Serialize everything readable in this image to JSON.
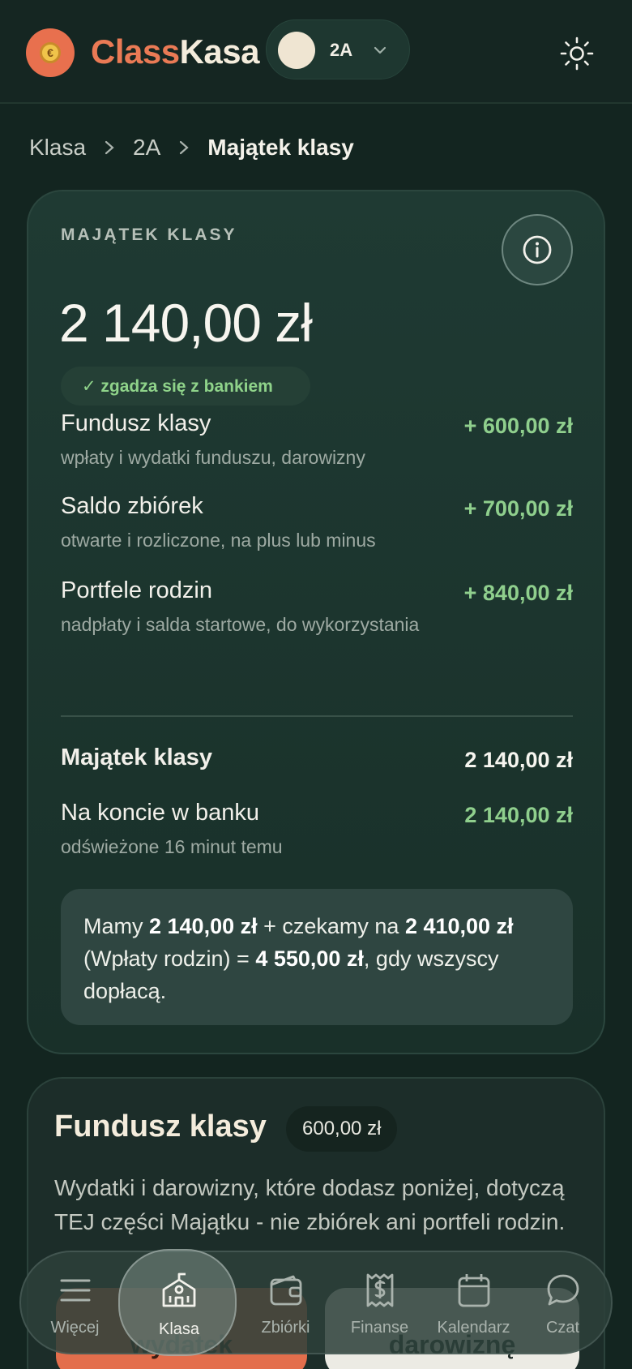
{
  "header": {
    "brand_part1": "Class",
    "brand_part2": "Kasa",
    "class_selector": "2A",
    "logo_icon": "coin-icon",
    "theme_icon": "sun-icon"
  },
  "breadcrumb": {
    "items": [
      "Klasa",
      "2A",
      "Majątek klasy"
    ]
  },
  "wealth_card": {
    "eyebrow": "MAJĄTEK KLASY",
    "total": "2 140,00 zł",
    "status_badge": "✓ zgadza się z bankiem",
    "rows": [
      {
        "label": "Fundusz klasy",
        "sub": "wpłaty i wydatki funduszu, darowizny",
        "value": "+ 600,00 zł"
      },
      {
        "label": "Saldo zbiórek",
        "sub": "otwarte i rozliczone, na plus lub minus",
        "value": "+ 700,00 zł"
      },
      {
        "label": "Portfele rodzin",
        "sub": "nadpłaty i salda startowe, do wykorzystania",
        "value": "+ 840,00 zł"
      }
    ],
    "summary": {
      "label": "Majątek klasy",
      "value": "2 140,00 zł"
    },
    "bank": {
      "label": "Na koncie w banku",
      "sub": "odświeżone 16 minut temu",
      "value": "2 140,00 zł"
    },
    "note": {
      "t1": "Mamy ",
      "b1": "2 140,00 zł",
      "t2": " + czekamy na ",
      "b2": "2 410,00 zł",
      "t3": " (Wpłaty rodzin) = ",
      "b3": "4 550,00 zł",
      "t4": ", gdy wszyscy dopłacą."
    }
  },
  "fund_card": {
    "title": "Fundusz klasy",
    "amount": "600,00 zł",
    "description": "Wydatki i darowizny, które dodasz poniżej, dotyczą TEJ części Majątku - nie zbiórek ani portfeli rodzin.",
    "button_expense": "wydatek",
    "button_donation": "darowiznę"
  },
  "bottom_nav": {
    "items": [
      {
        "label": "Więcej",
        "icon": "menu-icon"
      },
      {
        "label": "Klasa",
        "icon": "school-icon"
      },
      {
        "label": "Zbiórki",
        "icon": "wallet-icon"
      },
      {
        "label": "Finanse",
        "icon": "receipt-icon"
      },
      {
        "label": "Kalendarz",
        "icon": "calendar-icon"
      },
      {
        "label": "Czat",
        "icon": "chat-icon"
      }
    ],
    "active": "Klasa"
  }
}
